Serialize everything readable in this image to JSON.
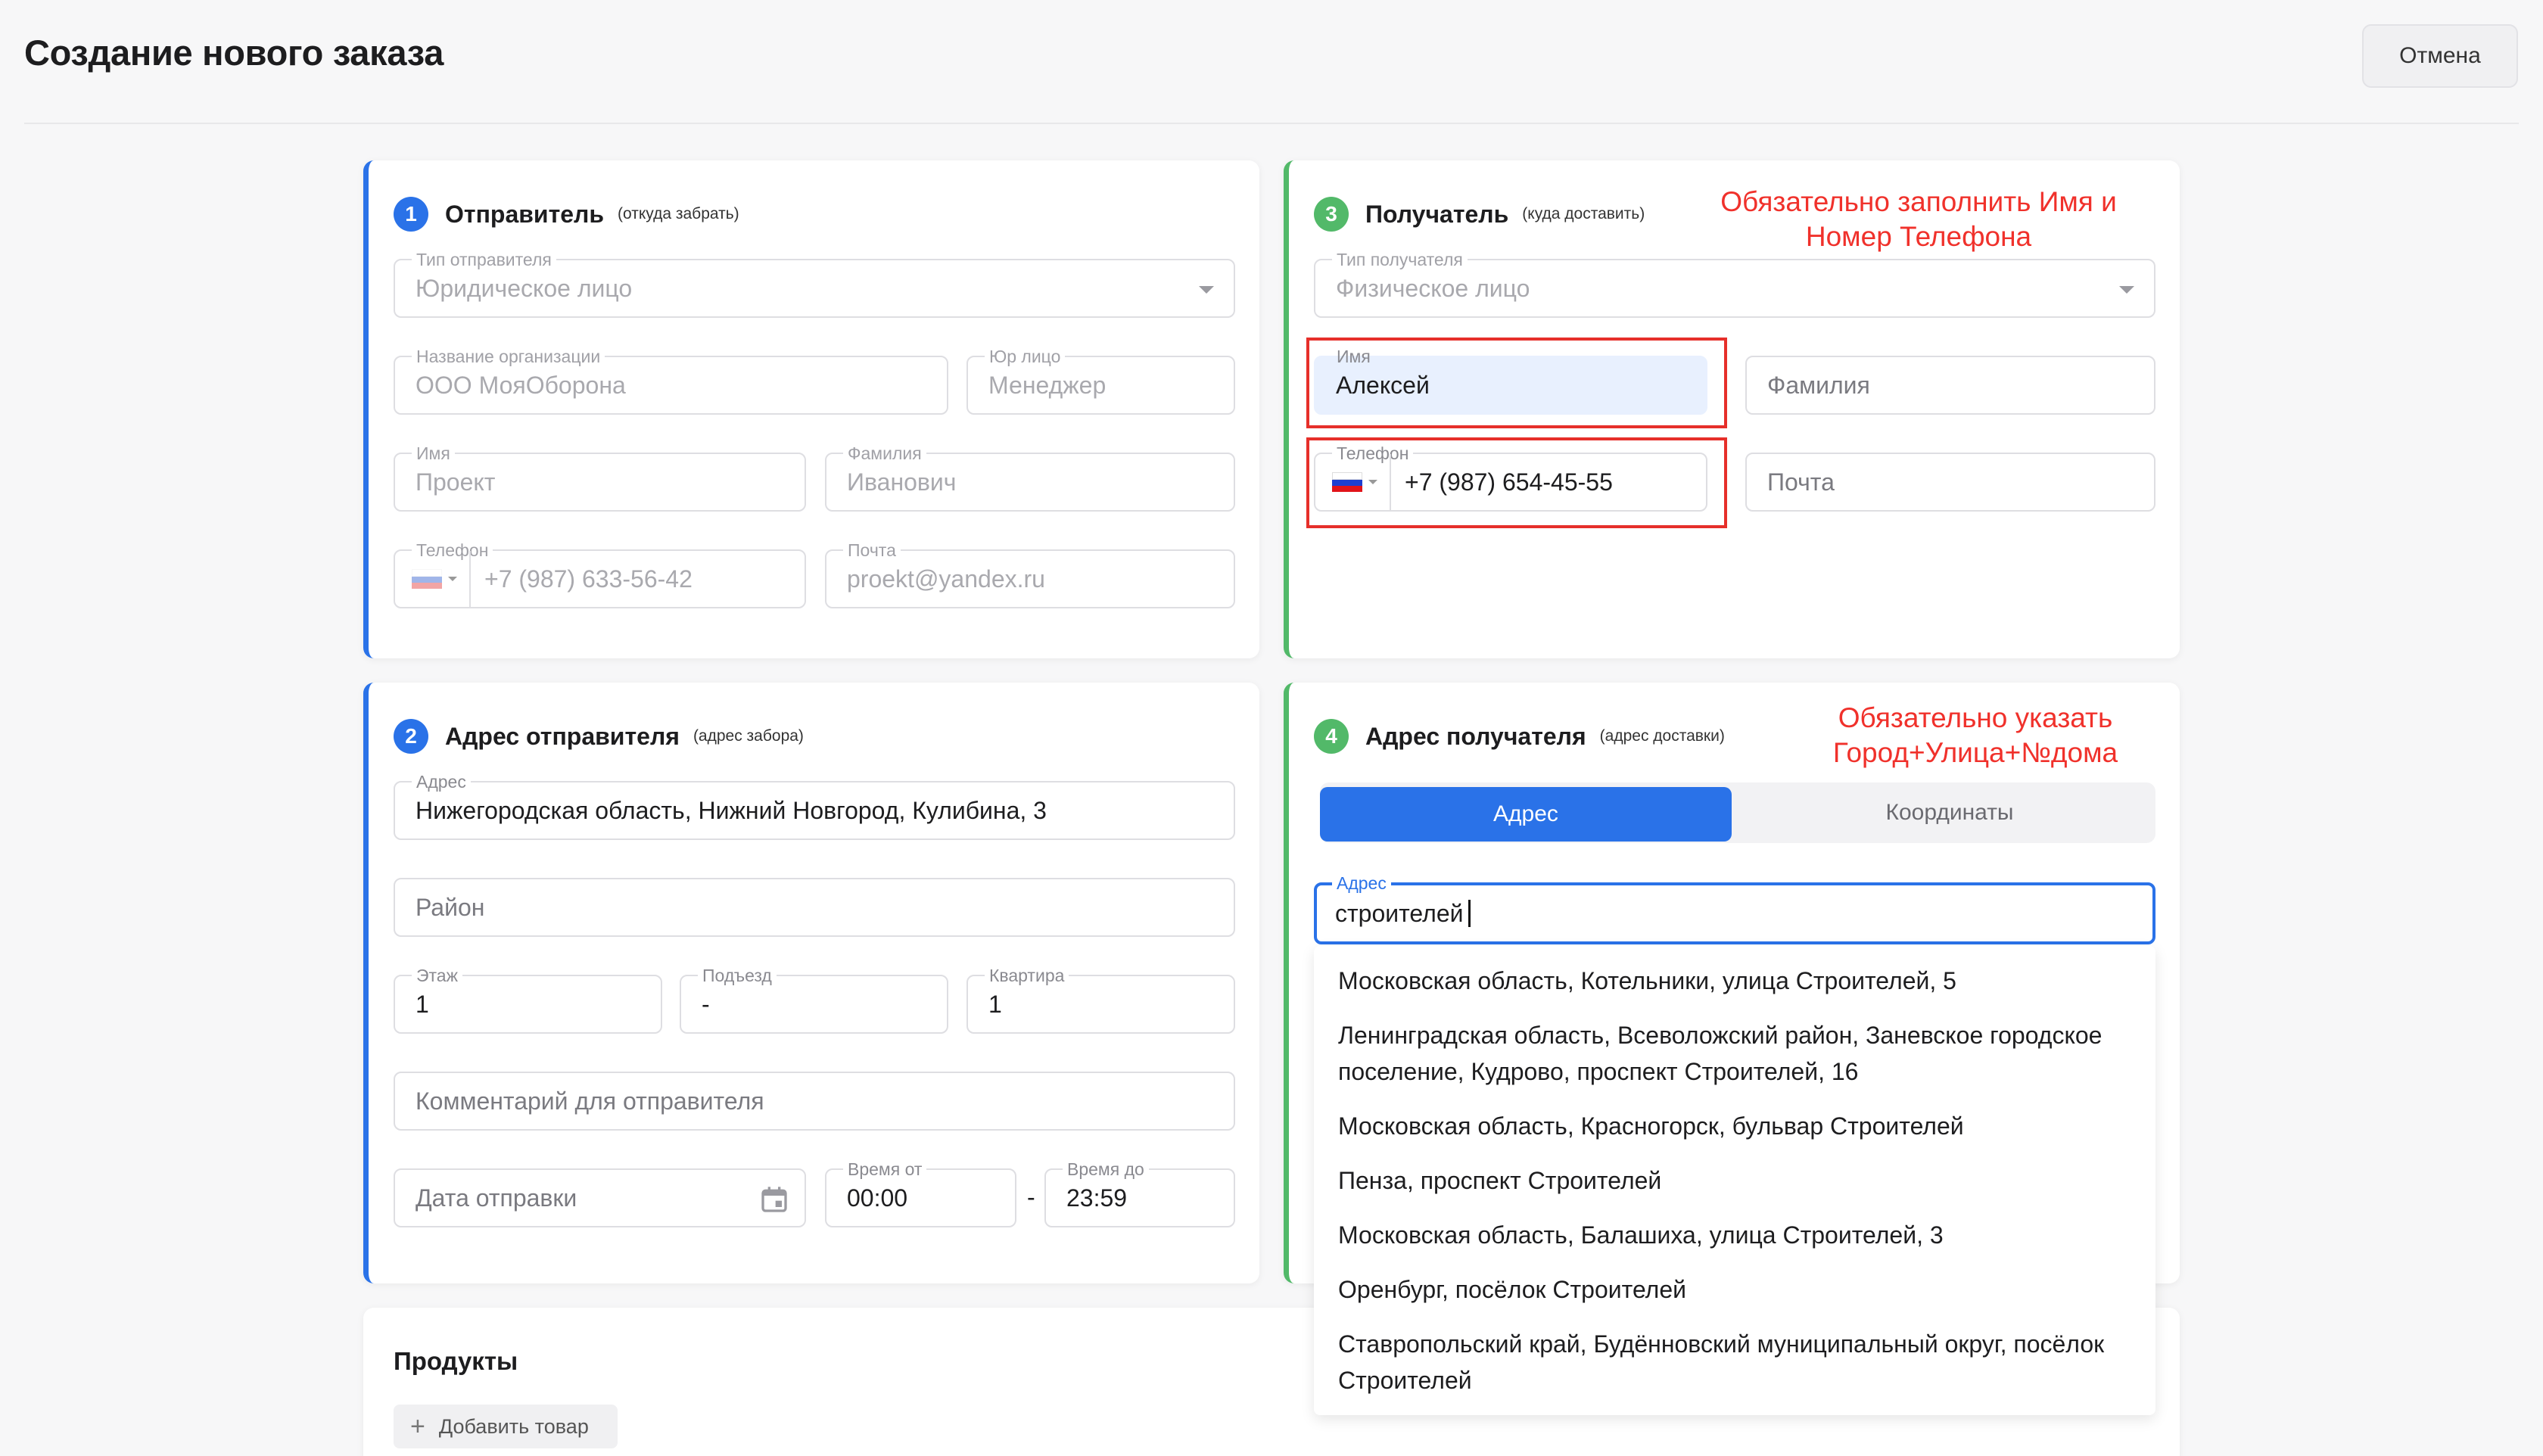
{
  "header": {
    "title": "Создание нового заказа",
    "cancel_label": "Отмена"
  },
  "sender": {
    "step": "1",
    "title": "Отправитель",
    "subtitle": "(откуда забрать)",
    "type_label": "Тип отправителя",
    "type_value": "Юридическое лицо",
    "org_label": "Название организации",
    "org_value": "ООО МояОборона",
    "role_label": "Юр лицо",
    "role_value": "Менеджер",
    "first_label": "Имя",
    "first_value": "Проект",
    "last_label": "Фамилия",
    "last_value": "Иванович",
    "phone_label": "Телефон",
    "phone_value": "+7 (987) 633-56-42",
    "email_label": "Почта",
    "email_value": "proekt@yandex.ru"
  },
  "recipient": {
    "step": "3",
    "title": "Получатель",
    "subtitle": "(куда доставить)",
    "type_label": "Тип получателя",
    "type_value": "Физическое лицо",
    "first_label": "Имя",
    "first_value": "Алексей",
    "last_placeholder": "Фамилия",
    "phone_label": "Телефон",
    "phone_value": "+7 (987) 654-45-55",
    "email_placeholder": "Почта",
    "note": "Обязательно заполнить Имя и Номер Телефона"
  },
  "sender_address": {
    "step": "2",
    "title": "Адрес отправителя",
    "subtitle": "(адрес забора)",
    "address_label": "Адрес",
    "address_value": "Нижегородская область, Нижний Новгород, Кулибина, 3",
    "district_placeholder": "Район",
    "floor_label": "Этаж",
    "floor_value": "1",
    "entrance_label": "Подъезд",
    "entrance_value": "-",
    "apt_label": "Квартира",
    "apt_value": "1",
    "comment_placeholder": "Комментарий для отправителя",
    "date_placeholder": "Дата отправки",
    "time_from_label": "Время от",
    "time_from_value": "00:00",
    "time_to_label": "Время до",
    "time_to_value": "23:59",
    "dash": "-"
  },
  "recipient_address": {
    "step": "4",
    "title": "Адрес получателя",
    "subtitle": "(адрес доставки)",
    "note": "Обязательно указать Город+Улица+№дома",
    "tab_address": "Адрес",
    "tab_coords": "Координаты",
    "address_label": "Адрес",
    "address_value": "строителей",
    "suggestions": [
      "Московская область, Котельники, улица Строителей, 5",
      "Ленинградская область, Всеволожский район, Заневское городское поселение, Кудрово, проспект Строителей, 16",
      "Московская область, Красногорск, бульвар Строителей",
      "Пенза, проспект Строителей",
      "Московская область, Балашиха, улица Строителей, 3",
      "Оренбург, посёлок Строителей",
      "Ставропольский край, Будённовский муниципальный округ, посёлок Строителей"
    ]
  },
  "products": {
    "title": "Продукты",
    "add_label": "Добавить товар"
  },
  "colors": {
    "accent": "#2a72e8",
    "success": "#52b969",
    "warning": "#e62f2a"
  }
}
